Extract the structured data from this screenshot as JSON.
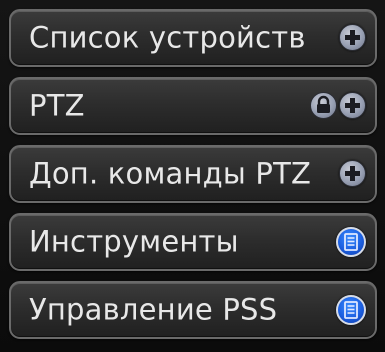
{
  "menu": {
    "items": [
      {
        "label": "Список устройств",
        "buttons": [
          "plus-icon"
        ]
      },
      {
        "label": "PTZ",
        "buttons": [
          "lock-icon",
          "plus-icon"
        ]
      },
      {
        "label": "Доп. команды PTZ",
        "buttons": [
          "plus-icon"
        ]
      },
      {
        "label": "Инструменты",
        "buttons": [
          "document-icon"
        ]
      },
      {
        "label": "Управление PSS",
        "buttons": [
          "document-icon"
        ]
      }
    ]
  },
  "colors": {
    "background": "#0e0e0e",
    "item_border": "#6a6a6a",
    "text": "#e8e8e8",
    "accent_blue": "#1c5fe0",
    "button_silver": "#98a0b3"
  }
}
